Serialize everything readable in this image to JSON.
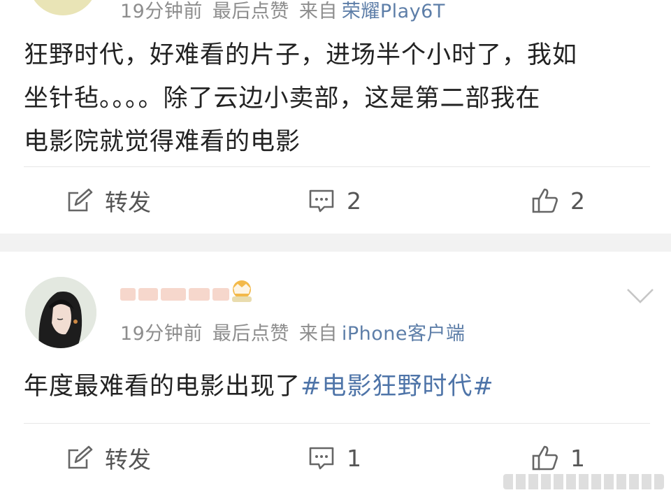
{
  "posts": [
    {
      "meta": {
        "time": "19分钟前",
        "last_like": "最后点赞",
        "source_prefix": "来自",
        "source": "荣耀Play6T"
      },
      "body": {
        "line1": "狂野时代，好难看的片子，进场半个小时了，我如",
        "line2": "坐针毡。。。。除了云边小卖部，这是第二部我在",
        "line3": "电影院就觉得难看的电影"
      },
      "actions": {
        "repost": "转发",
        "comments": "2",
        "likes": "2"
      }
    },
    {
      "meta": {
        "time": "19分钟前",
        "last_like": "最后点赞",
        "source_prefix": "来自",
        "source": "iPhone客户端"
      },
      "body": {
        "text": "年度最难看的电影出现了",
        "topic": "#电影狂野时代#"
      },
      "actions": {
        "repost": "转发",
        "comments": "1",
        "likes": "1"
      }
    }
  ],
  "icons": {
    "repost": "edit-square-icon",
    "comment": "comment-bubble-icon",
    "like": "thumbs-up-icon",
    "more": "chevron-down-icon",
    "badge": "crown-badge-icon"
  },
  "colors": {
    "topic": "#4e74a8",
    "meta": "#8d8d8d",
    "separator": "#f2f2f2"
  }
}
